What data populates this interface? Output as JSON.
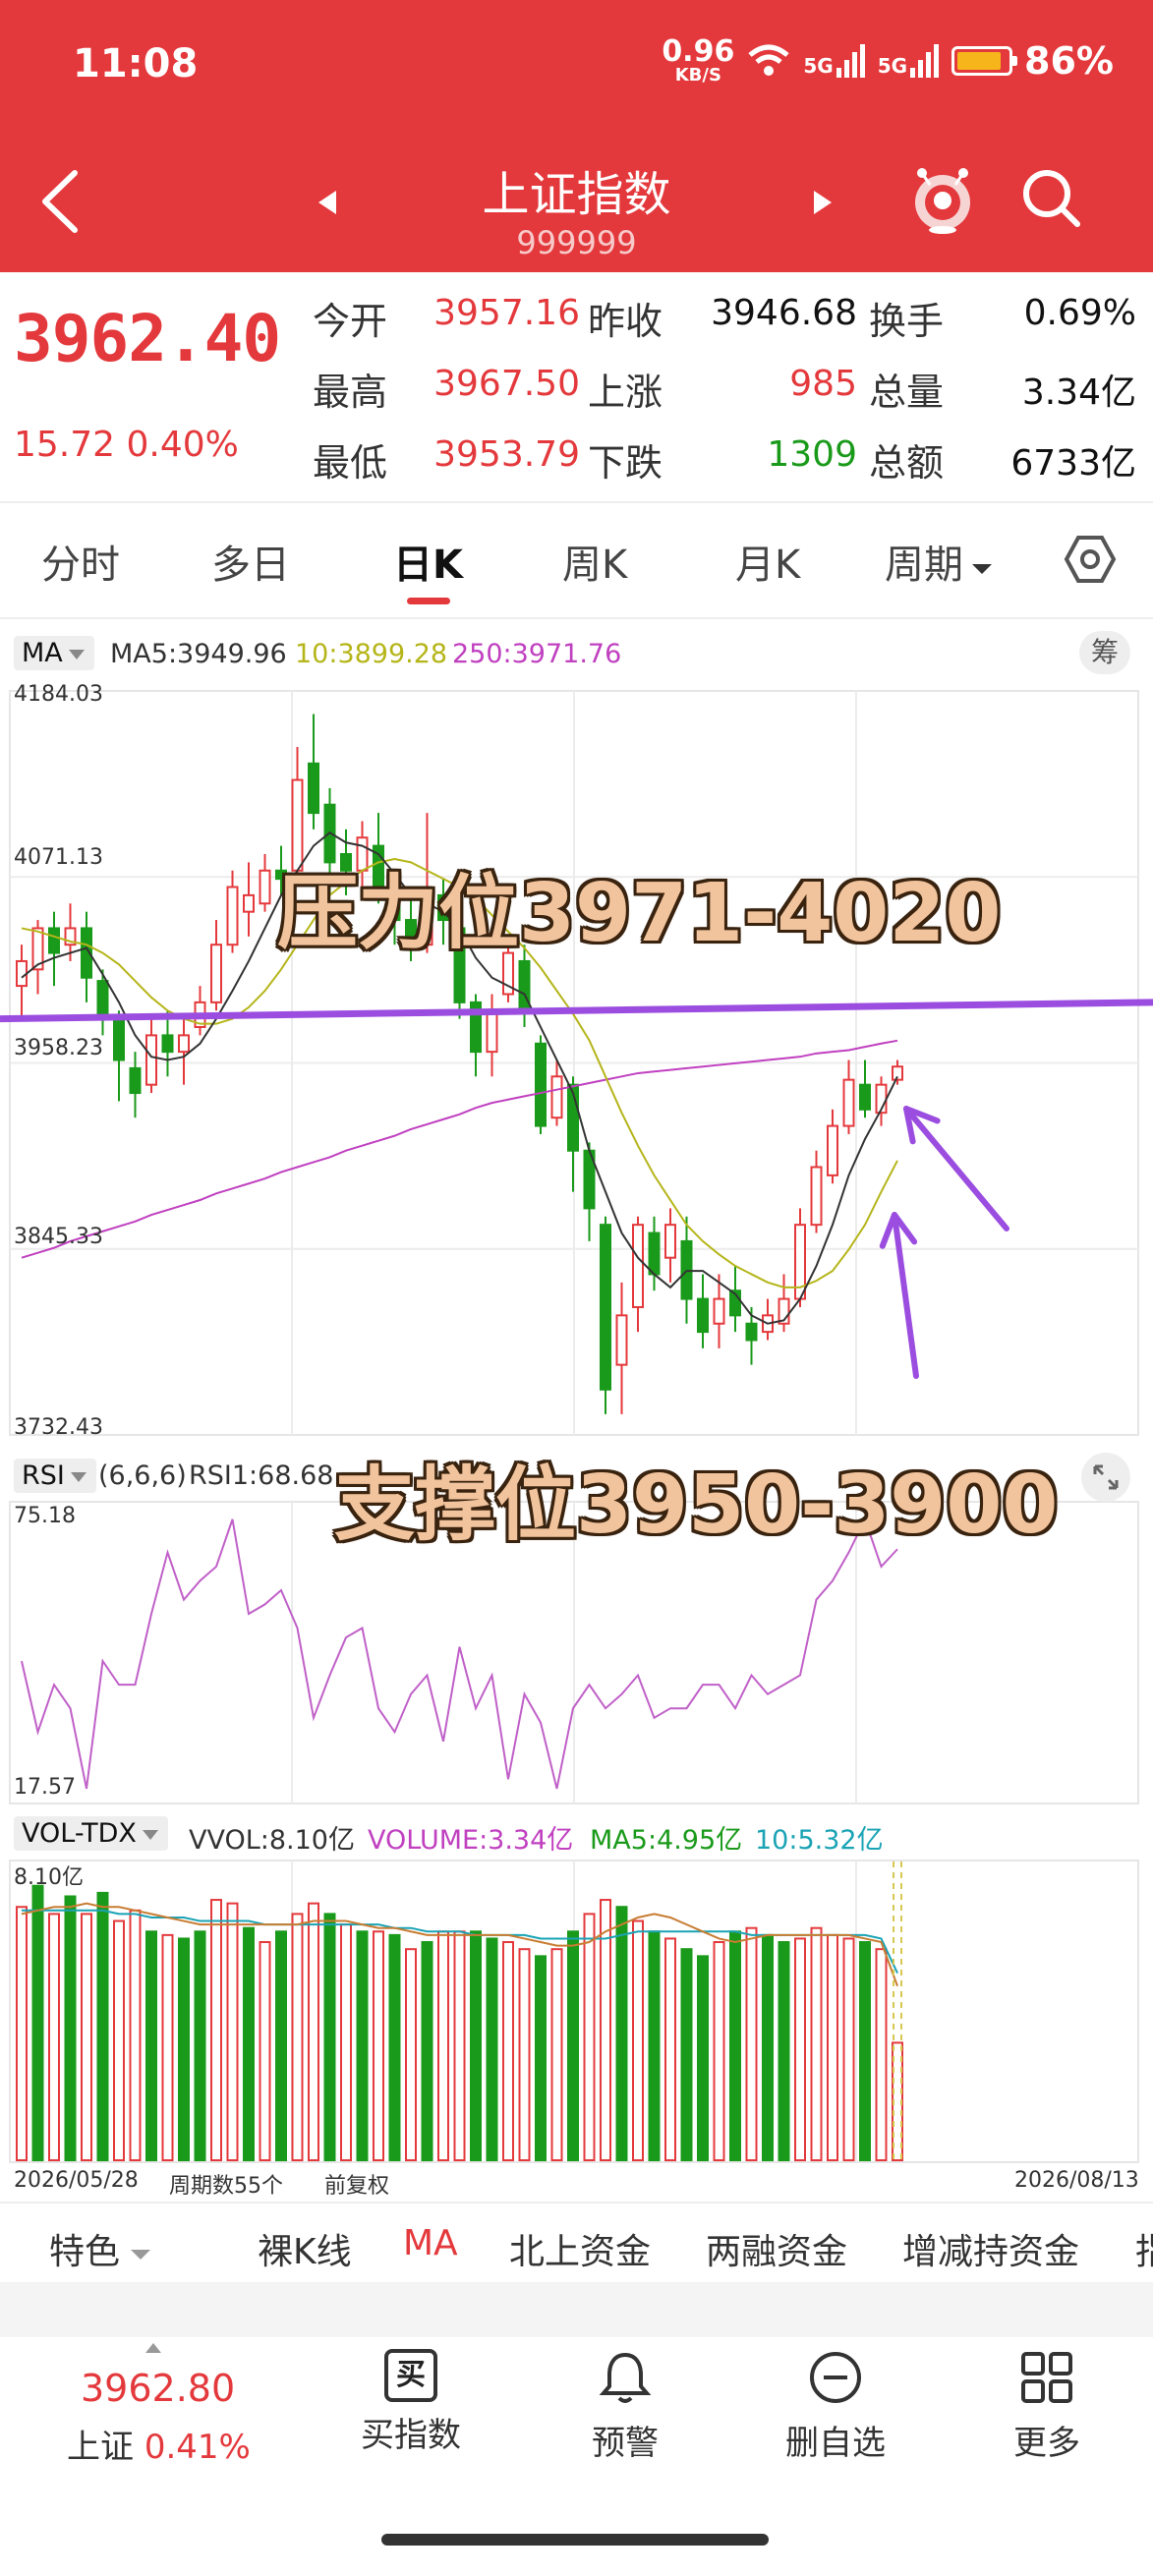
{
  "status_bar": {
    "time": "11:08",
    "net_speed": "0.96",
    "net_unit": "KB/S",
    "signal1": "5G",
    "signal2": "5G",
    "battery": "86%"
  },
  "header": {
    "title": "上证指数",
    "code": "999999"
  },
  "quote": {
    "price": "3962.40",
    "change": "15.72",
    "change_pct": "0.40%",
    "rows": [
      {
        "l1": "今开",
        "v1": "3957.16",
        "l2": "昨收",
        "v2": "3946.68",
        "l3": "换手",
        "v3": "0.69%"
      },
      {
        "l1": "最高",
        "v1": "3967.50",
        "l2": "上涨",
        "v2": "985",
        "l3": "总量",
        "v3": "3.34亿"
      },
      {
        "l1": "最低",
        "v1": "3953.79",
        "l2": "下跌",
        "v2": "1309",
        "l3": "总额",
        "v3": "6733亿"
      }
    ]
  },
  "tabs": [
    "分时",
    "多日",
    "日K",
    "周K",
    "月K",
    "周期"
  ],
  "active_tab": "日K",
  "kline": {
    "indicator_name": "MA",
    "ma5": "MA5:3949.96",
    "ma10": "10:3899.28",
    "ma250": "250:3971.76",
    "chip_label": "筹",
    "y_labels": [
      "4184.03",
      "4071.13",
      "3958.23",
      "3845.33",
      "3732.43"
    ]
  },
  "rsi": {
    "name": "RSI",
    "params": "(6,6,6)",
    "value": "RSI1:68.68",
    "y_top": "75.18",
    "y_bottom": "17.57"
  },
  "vol": {
    "name": "VOL-TDX",
    "vvol": "VVOL:8.10亿",
    "volume": "VOLUME:3.34亿",
    "ma5": "MA5:4.95亿",
    "ma10": "10:5.32亿",
    "y_top": "8.10亿",
    "date_start": "2026/05/28",
    "period_count": "周期数55个",
    "adjust": "前复权",
    "date_end": "2026/08/13"
  },
  "annotations": {
    "resistance": "压力位3971-4020",
    "support": "支撑位3950-3900"
  },
  "features": [
    "特色",
    "裸K线",
    "MA",
    "北上资金",
    "两融资金",
    "增减持资金",
    "指"
  ],
  "bottom": {
    "price": "3962.80",
    "name": "上证",
    "pct": "0.41%",
    "nav": [
      "买指数",
      "预警",
      "删自选",
      "更多"
    ],
    "buy_icon_char": "买"
  },
  "colors": {
    "brand_red": "#e4393c",
    "down_green": "#1a9a1a",
    "ma5": "#333333",
    "ma10": "#b5b51a",
    "ma250": "#c040c0",
    "resistance_line": "#9b4de0"
  },
  "chart_data": [
    {
      "type": "candlestick",
      "title": "",
      "ylim": [
        3732.43,
        4184.03
      ],
      "y_ticks": [
        4184.03,
        4071.13,
        3958.23,
        3845.33,
        3732.43
      ],
      "candles": [
        [
          4005,
          4020,
          3985,
          4030
        ],
        [
          4015,
          4040,
          4000,
          4045
        ],
        [
          4040,
          4025,
          4005,
          4050
        ],
        [
          4030,
          4040,
          4020,
          4055
        ],
        [
          4040,
          4010,
          3995,
          4050
        ],
        [
          4008,
          3985,
          3975,
          4015
        ],
        [
          3985,
          3960,
          3935,
          3990
        ],
        [
          3955,
          3940,
          3925,
          3965
        ],
        [
          3945,
          3975,
          3940,
          3985
        ],
        [
          3975,
          3965,
          3950,
          3990
        ],
        [
          3965,
          3975,
          3945,
          3985
        ],
        [
          3980,
          3995,
          3975,
          4005
        ],
        [
          3995,
          4030,
          3990,
          4045
        ],
        [
          4030,
          4065,
          4025,
          4075
        ],
        [
          4050,
          4060,
          4035,
          4080
        ],
        [
          4055,
          4075,
          4050,
          4085
        ],
        [
          4075,
          4070,
          4060,
          4090
        ],
        [
          4075,
          4130,
          4070,
          4150
        ],
        [
          4140,
          4110,
          4100,
          4170
        ],
        [
          4115,
          4080,
          4060,
          4125
        ],
        [
          4085,
          4075,
          4060,
          4100
        ],
        [
          4075,
          4095,
          4060,
          4105
        ],
        [
          4090,
          4065,
          4055,
          4110
        ],
        [
          4060,
          4045,
          4030,
          4065
        ],
        [
          4045,
          4030,
          4020,
          4060
        ],
        [
          4030,
          4055,
          4025,
          4110
        ],
        [
          4060,
          4045,
          4030,
          4070
        ],
        [
          4040,
          3995,
          3985,
          4050
        ],
        [
          3995,
          3965,
          3950,
          4000
        ],
        [
          3965,
          3990,
          3950,
          4000
        ],
        [
          4000,
          4025,
          3995,
          4035
        ],
        [
          4020,
          3990,
          3980,
          4030
        ],
        [
          3970,
          3920,
          3915,
          3975
        ],
        [
          3925,
          3950,
          3920,
          3960
        ],
        [
          3945,
          3905,
          3880,
          3950
        ],
        [
          3905,
          3870,
          3850,
          3910
        ],
        [
          3860,
          3760,
          3745,
          3865
        ],
        [
          3775,
          3805,
          3745,
          3825
        ],
        [
          3810,
          3860,
          3795,
          3865
        ],
        [
          3855,
          3830,
          3820,
          3865
        ],
        [
          3840,
          3860,
          3825,
          3870
        ],
        [
          3850,
          3815,
          3800,
          3865
        ],
        [
          3815,
          3795,
          3785,
          3830
        ],
        [
          3800,
          3815,
          3785,
          3830
        ],
        [
          3820,
          3805,
          3795,
          3835
        ],
        [
          3800,
          3790,
          3775,
          3810
        ],
        [
          3795,
          3805,
          3790,
          3815
        ],
        [
          3800,
          3815,
          3795,
          3830
        ],
        [
          3815,
          3860,
          3810,
          3870
        ],
        [
          3860,
          3895,
          3855,
          3905
        ],
        [
          3890,
          3920,
          3885,
          3930
        ],
        [
          3920,
          3948,
          3915,
          3960
        ],
        [
          3945,
          3930,
          3925,
          3960
        ],
        [
          3928,
          3945,
          3920,
          3950
        ],
        [
          3948,
          3956,
          3945,
          3960
        ]
      ],
      "ma5": [
        4010,
        4018,
        4022,
        4025,
        4028,
        4012,
        3995,
        3975,
        3962,
        3960,
        3962,
        3970,
        3985,
        4002,
        4020,
        4040,
        4060,
        4075,
        4090,
        4098,
        4092,
        4090,
        4085,
        4073,
        4060,
        4055,
        4050,
        4040,
        4022,
        4010,
        4005,
        4000,
        3980,
        3960,
        3940,
        3905,
        3880,
        3855,
        3840,
        3830,
        3822,
        3832,
        3832,
        3825,
        3818,
        3805,
        3800,
        3802,
        3815,
        3835,
        3860,
        3890,
        3912,
        3930,
        3950
      ],
      "ma10": [
        4040,
        4038,
        4035,
        4032,
        4030,
        4025,
        4018,
        4008,
        3998,
        3990,
        3985,
        3982,
        3982,
        3985,
        3992,
        4002,
        4015,
        4030,
        4045,
        4060,
        4068,
        4075,
        4080,
        4082,
        4080,
        4075,
        4070,
        4065,
        4058,
        4048,
        4038,
        4028,
        4016,
        4002,
        3988,
        3972,
        3950,
        3928,
        3908,
        3890,
        3875,
        3860,
        3850,
        3842,
        3835,
        3830,
        3825,
        3822,
        3822,
        3826,
        3832,
        3845,
        3860,
        3880,
        3899
      ],
      "ma250": [
        3840,
        3843,
        3846,
        3850,
        3853,
        3856,
        3859,
        3862,
        3866,
        3869,
        3872,
        3875,
        3879,
        3882,
        3885,
        3888,
        3892,
        3895,
        3898,
        3901,
        3905,
        3908,
        3911,
        3914,
        3918,
        3921,
        3924,
        3927,
        3931,
        3934,
        3936,
        3938,
        3940,
        3942,
        3944,
        3946,
        3948,
        3950,
        3952,
        3953,
        3954,
        3955,
        3956,
        3957,
        3958,
        3959,
        3960,
        3961,
        3962,
        3964,
        3965,
        3966,
        3968,
        3970,
        3971.76
      ],
      "resistance_line": [
        3985,
        3995
      ]
    },
    {
      "type": "line",
      "title": "",
      "ylim": [
        17.57,
        75.18
      ],
      "series": [
        {
          "name": "RSI1",
          "values": [
            45,
            30,
            40,
            35,
            18,
            45,
            40,
            40,
            55,
            68,
            58,
            62,
            65,
            75,
            55,
            57,
            60,
            52,
            33,
            42,
            50,
            52,
            35,
            30,
            38,
            42,
            28,
            48,
            35,
            42,
            20,
            38,
            32,
            18,
            35,
            40,
            35,
            38,
            42,
            33,
            35,
            35,
            40,
            40,
            35,
            42,
            38,
            40,
            42,
            58,
            62,
            68,
            75,
            65,
            68.68
          ]
        }
      ]
    },
    {
      "type": "bar",
      "title": "",
      "ylim": [
        0,
        8.1
      ],
      "values": [
        7.2,
        7.8,
        7.0,
        7.5,
        7.0,
        7.6,
        6.8,
        7.1,
        6.5,
        6.4,
        6.3,
        6.5,
        7.4,
        7.3,
        6.6,
        6.2,
        6.5,
        7.0,
        7.3,
        7.0,
        6.7,
        6.5,
        6.5,
        6.4,
        6.0,
        6.2,
        6.5,
        6.5,
        6.5,
        6.3,
        6.2,
        6.0,
        5.8,
        6.0,
        6.5,
        7.0,
        7.4,
        7.2,
        6.8,
        6.5,
        6.3,
        6.0,
        5.8,
        6.2,
        6.5,
        6.6,
        6.4,
        6.2,
        6.3,
        6.6,
        6.4,
        6.3,
        6.2,
        6.0,
        3.34
      ],
      "up": [
        1,
        0,
        1,
        0,
        1,
        0,
        1,
        1,
        0,
        1,
        0,
        0,
        1,
        1,
        0,
        1,
        0,
        1,
        1,
        0,
        1,
        0,
        1,
        0,
        1,
        0,
        1,
        1,
        0,
        0,
        1,
        1,
        0,
        1,
        0,
        1,
        1,
        0,
        1,
        0,
        1,
        0,
        0,
        1,
        0,
        1,
        0,
        0,
        1,
        1,
        1,
        1,
        0,
        1,
        1
      ],
      "ma5": [
        7.0,
        7.1,
        7.2,
        7.2,
        7.3,
        7.2,
        7.2,
        7.1,
        7.0,
        6.9,
        6.8,
        6.7,
        6.7,
        6.7,
        6.7,
        6.7,
        6.7,
        6.7,
        6.8,
        6.8,
        6.8,
        6.7,
        6.6,
        6.6,
        6.5,
        6.4,
        6.4,
        6.4,
        6.4,
        6.4,
        6.4,
        6.3,
        6.2,
        6.1,
        6.1,
        6.2,
        6.5,
        6.7,
        6.9,
        7.0,
        6.9,
        6.7,
        6.5,
        6.3,
        6.2,
        6.3,
        6.4,
        6.4,
        6.4,
        6.4,
        6.4,
        6.4,
        6.3,
        6.2,
        4.95
      ],
      "ma10": [
        7.1,
        7.1,
        7.1,
        7.1,
        7.1,
        7.1,
        7.0,
        7.0,
        6.9,
        6.9,
        6.9,
        6.8,
        6.8,
        6.8,
        6.8,
        6.7,
        6.7,
        6.7,
        6.7,
        6.7,
        6.7,
        6.7,
        6.7,
        6.6,
        6.6,
        6.5,
        6.5,
        6.5,
        6.4,
        6.4,
        6.4,
        6.4,
        6.3,
        6.3,
        6.3,
        6.3,
        6.3,
        6.4,
        6.5,
        6.5,
        6.5,
        6.5,
        6.5,
        6.5,
        6.5,
        6.4,
        6.4,
        6.4,
        6.4,
        6.4,
        6.4,
        6.4,
        6.4,
        6.3,
        5.32
      ]
    }
  ]
}
